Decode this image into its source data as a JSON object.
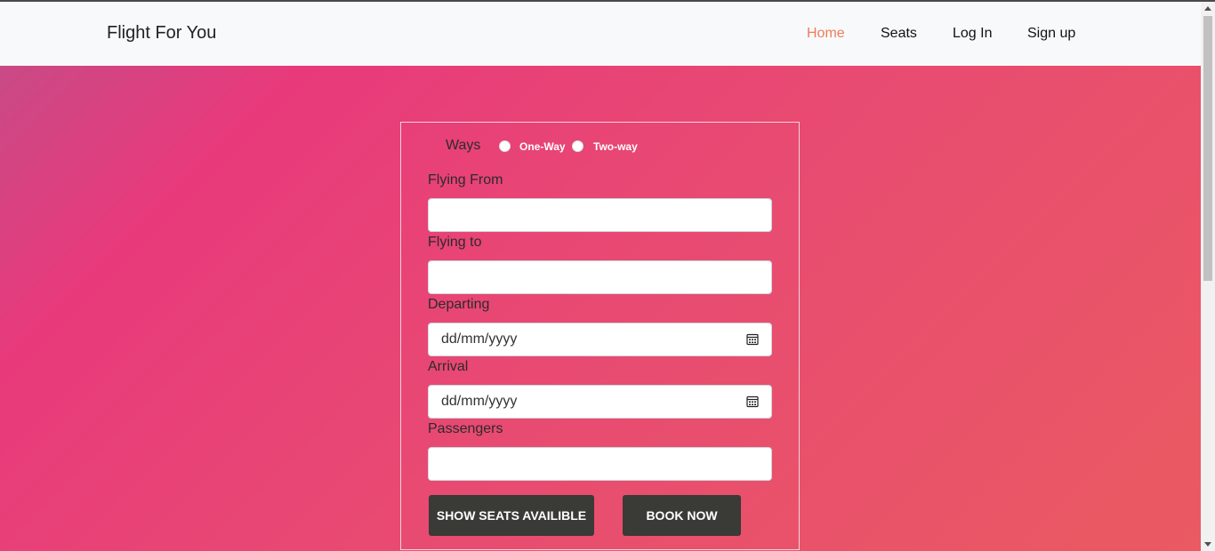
{
  "navbar": {
    "brand": "Flight For You",
    "links": [
      {
        "label": "Home",
        "active": true
      },
      {
        "label": "Seats",
        "active": false
      },
      {
        "label": "Log In",
        "active": false
      },
      {
        "label": "Sign up",
        "active": false
      }
    ]
  },
  "form": {
    "ways_label": "Ways",
    "ways_options": [
      "One-Way",
      "Two-way"
    ],
    "flying_from_label": "Flying From",
    "flying_from_value": "",
    "flying_to_label": "Flying to",
    "flying_to_value": "",
    "departing_label": "Departing",
    "departing_placeholder": "dd/mm/yyyy",
    "arrival_label": "Arrival",
    "arrival_placeholder": "dd/mm/yyyy",
    "passengers_label": "Passengers",
    "passengers_value": "",
    "show_seats_button": "SHOW SEATS AVAILIBLE",
    "book_now_button": "BOOK NOW"
  },
  "colors": {
    "active_link": "#f07b5a",
    "button_bg": "#3a3a36",
    "hero_gradient_start": "#c94a86",
    "hero_gradient_end": "#ea5a62"
  },
  "icons": {
    "calendar": "calendar-icon"
  }
}
